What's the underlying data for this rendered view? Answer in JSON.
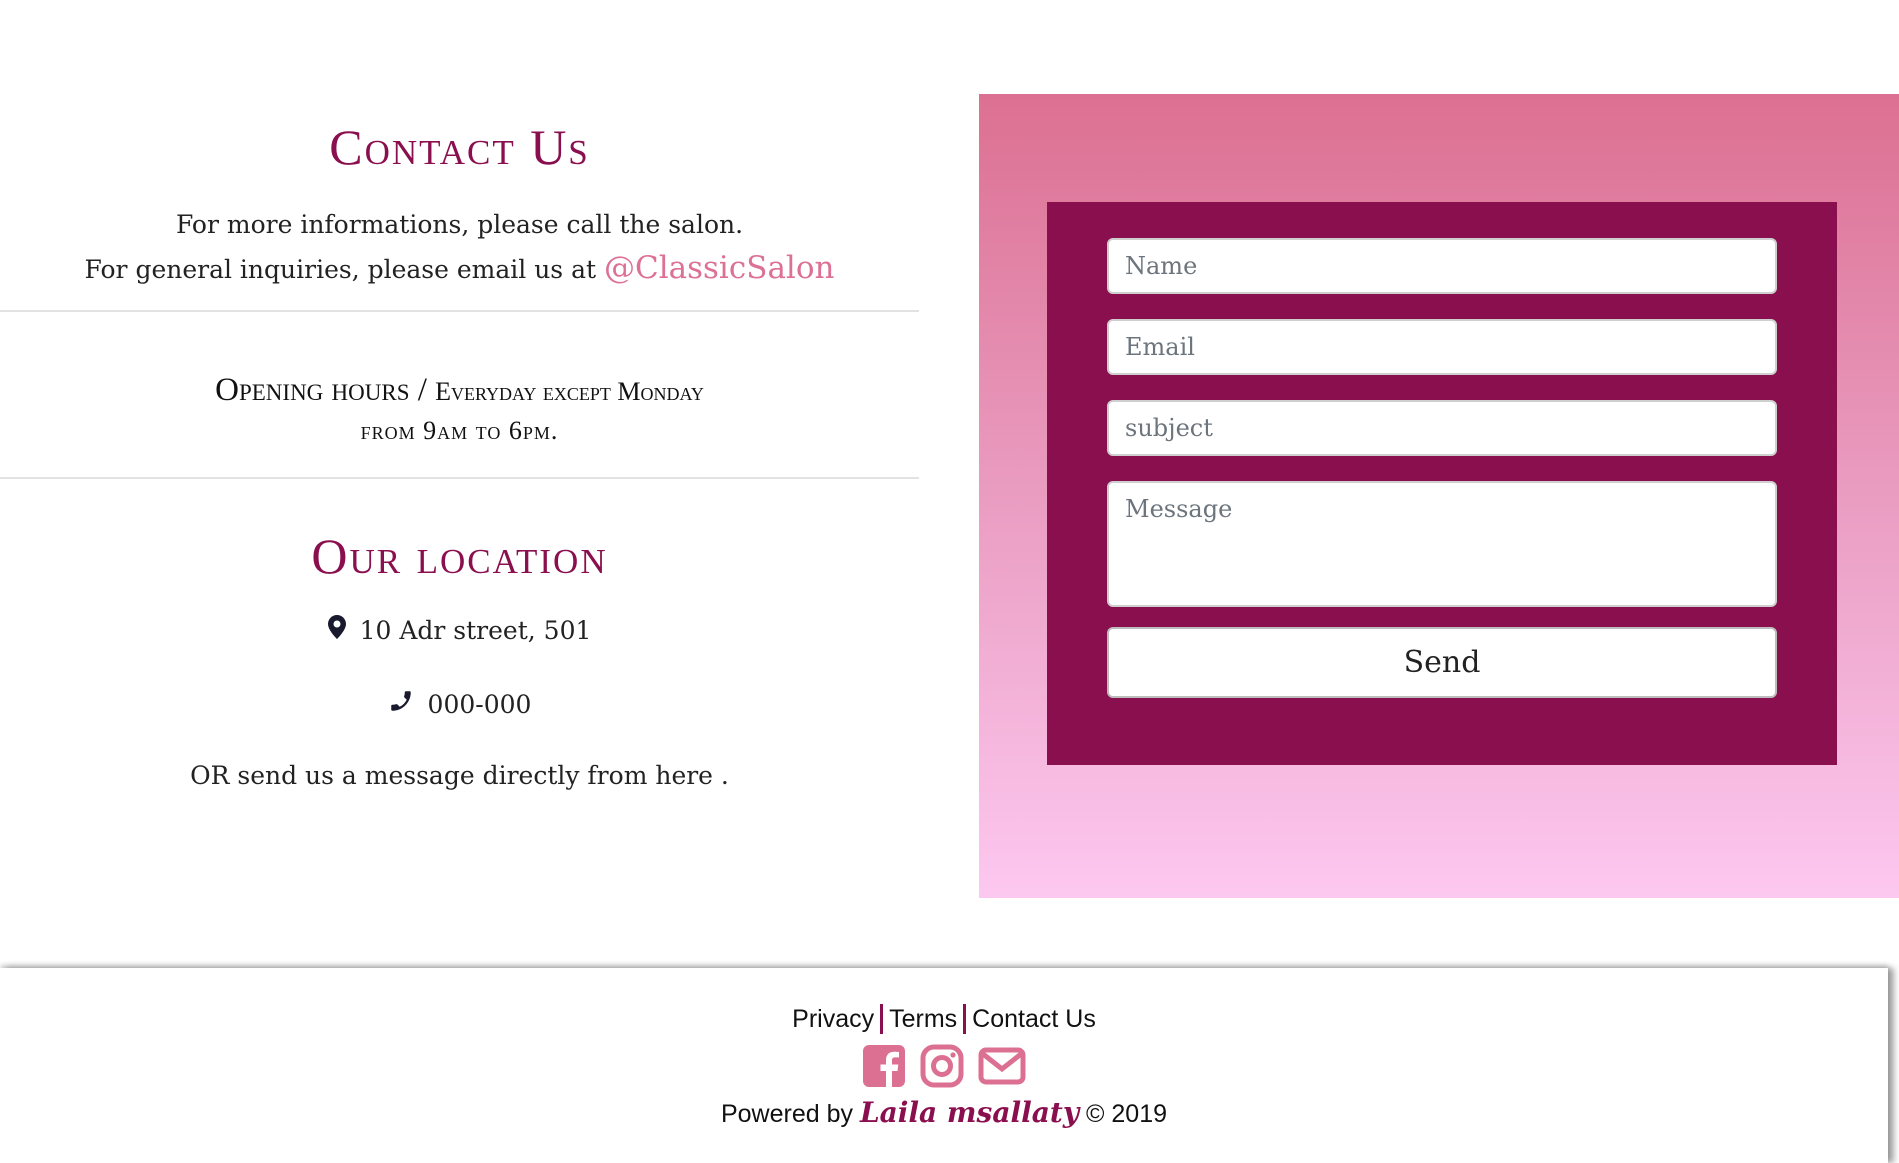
{
  "contact": {
    "title": "Contact Us",
    "intro_line1": "For more informations, please call the salon.",
    "intro_line2_prefix": "For general inquiries, please email us at ",
    "email_handle": "@ClassicSalon"
  },
  "hours": {
    "label": "Opening hours",
    "separator": " / ",
    "line1_rest": "Everyday except Monday",
    "line2": "from 9am to 6pm."
  },
  "location": {
    "title": "Our location",
    "address": "10 Adr street, 501",
    "phone": "000-000",
    "message_line": "OR send us a message directly from here ."
  },
  "form": {
    "name_placeholder": "Name",
    "email_placeholder": "Email",
    "subject_placeholder": "subject",
    "message_placeholder": "Message",
    "send_label": "Send"
  },
  "footer": {
    "links": [
      "Privacy",
      "Terms",
      "Contact Us"
    ],
    "social_icons": [
      "facebook-icon",
      "instagram-icon",
      "envelope-icon"
    ],
    "powered_prefix": "Powered by ",
    "author": "Laila msallaty",
    "copyright": " © 2019"
  },
  "colors": {
    "brand": "#8a0f4e",
    "accent_pink": "#dc7092",
    "gradient_end": "#fdc8f0"
  }
}
